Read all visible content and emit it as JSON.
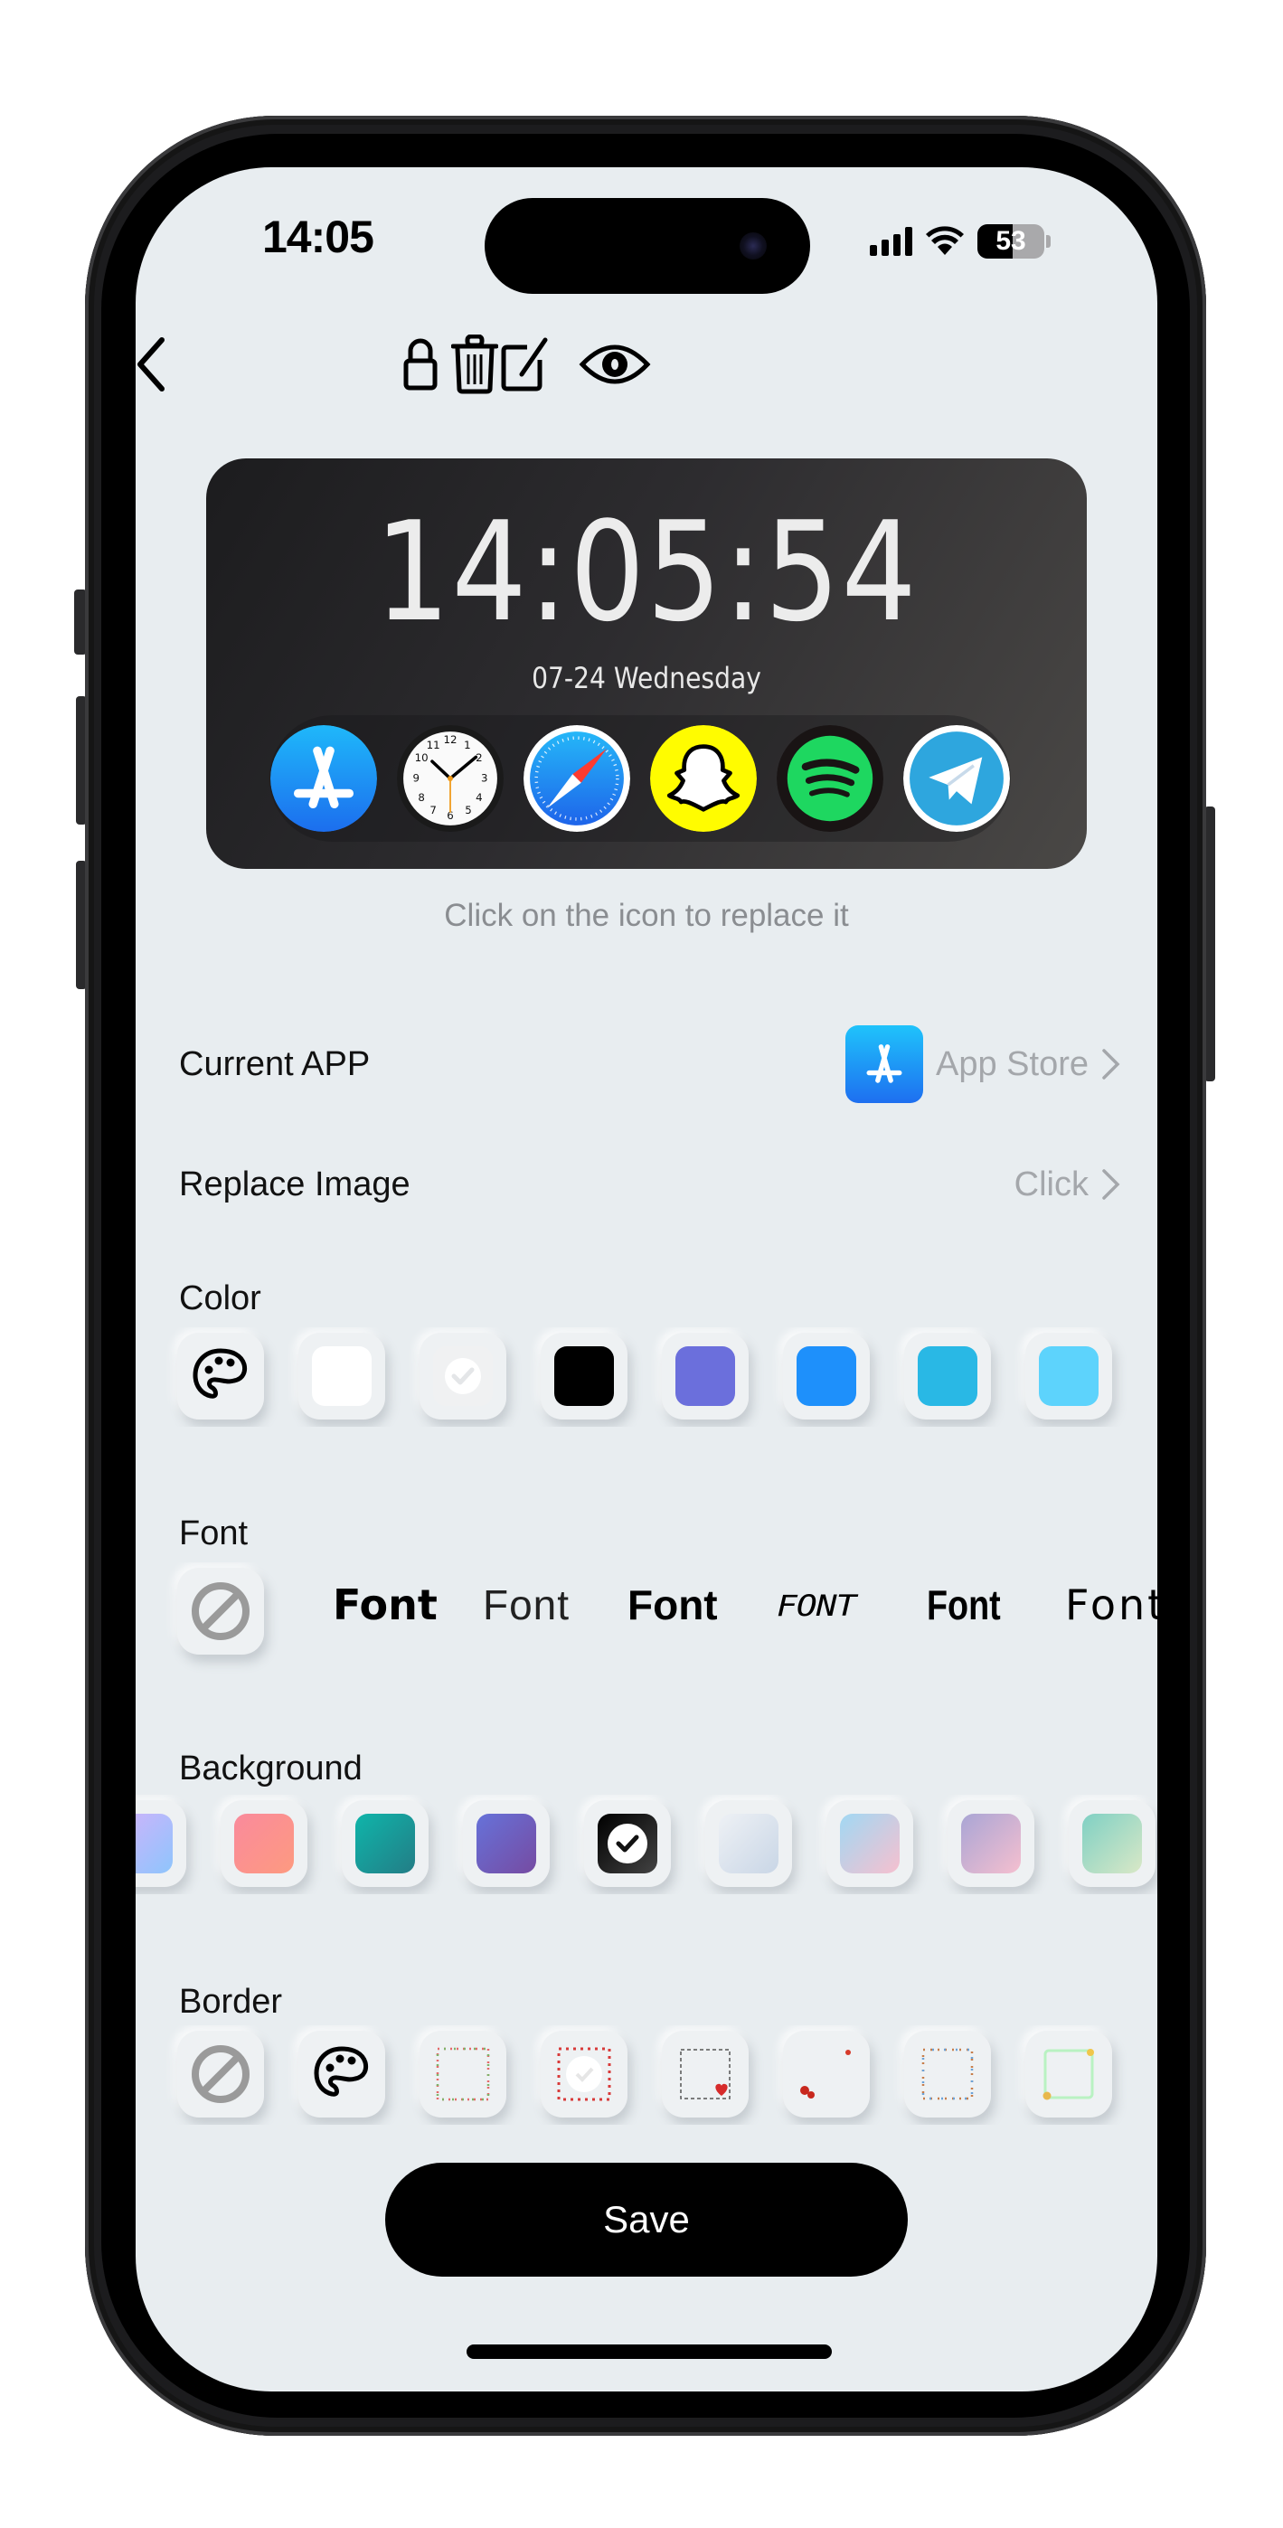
{
  "status_bar": {
    "time": "14:05",
    "battery_level": 53,
    "battery_label": "53"
  },
  "nav": {
    "icons": [
      "back-icon",
      "lock-icon",
      "trash-icon",
      "edit-icon",
      "eye-icon"
    ]
  },
  "widget": {
    "time": "14:05:54",
    "date": "07-24 Wednesday",
    "apps": [
      {
        "name": "App Store",
        "icon": "app-store-icon"
      },
      {
        "name": "Clock",
        "icon": "clock-icon"
      },
      {
        "name": "Safari",
        "icon": "safari-icon"
      },
      {
        "name": "Snapchat",
        "icon": "snapchat-icon"
      },
      {
        "name": "Spotify",
        "icon": "spotify-icon"
      },
      {
        "name": "Telegram",
        "icon": "telegram-icon"
      }
    ]
  },
  "hint": "Click on the icon to replace it",
  "current_app": {
    "label": "Current APP",
    "value": "App Store"
  },
  "replace_image": {
    "label": "Replace Image",
    "value": "Click"
  },
  "color": {
    "title": "Color",
    "custom_icon": "palette-icon",
    "swatches": [
      "#ffffff",
      "#f0f1f2",
      "#000000",
      "#6b6fdc",
      "#1e90fb",
      "#29b8e5",
      "#5dd3fc"
    ],
    "selected_index": 1
  },
  "font": {
    "title": "Font",
    "none_icon": "no-font-icon",
    "options": [
      "Font",
      "Font",
      "Font",
      "FONT",
      "Font",
      "Font"
    ]
  },
  "background": {
    "title": "Background",
    "swatches": [
      [
        "#d3b2fb",
        "#8ec5fc"
      ],
      [
        "#fa8a9c",
        "#fd9a80"
      ],
      [
        "#0fb5aa",
        "#237d86"
      ],
      [
        "#6672d9",
        "#764ba2"
      ],
      [
        "#000000",
        "#434343"
      ],
      [
        "#eef1f5",
        "#c9d6e6"
      ],
      [
        "#a1d8f3",
        "#f6c0cf"
      ],
      [
        "#a9a5d5",
        "#f5bfcf"
      ],
      [
        "#7fd0c4",
        "#d9e8c6"
      ]
    ],
    "selected_index": 4
  },
  "border": {
    "title": "Border",
    "none_icon": "no-border-icon",
    "custom_icon": "palette-icon",
    "patterns": [
      "dotted-floral",
      "red-hearts-selected",
      "sketch-heart",
      "corner-roses",
      "multicolor-dots",
      "green-floral"
    ]
  },
  "save_label": "Save"
}
